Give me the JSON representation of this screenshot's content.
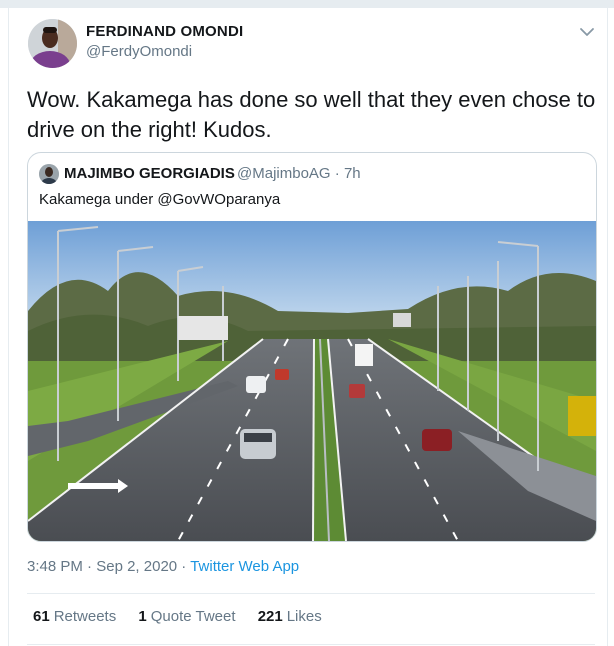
{
  "tweet": {
    "author_name": "FERDINAND OMONDI",
    "author_handle": "@FerdyOmondi",
    "text": "Wow. Kakamega has done so well that they even chose to drive on the right! Kudos.",
    "menu_icon": "chevron-down-icon",
    "time": "3:48 PM",
    "date": "Sep 2, 2020",
    "separator": "·",
    "source_app": "Twitter Web App"
  },
  "quote": {
    "author_name": "MAJIMBO GEORGIADIS",
    "author_handle": "@MajimboAG",
    "separator": "·",
    "age": "7h",
    "text": "Kakamega under @GovWOparanya",
    "media_description_icon": "highway-photo"
  },
  "stats": {
    "retweets_count": "61",
    "retweets_label": "Retweets",
    "quotes_count": "1",
    "quotes_label": "Quote Tweet",
    "likes_count": "221",
    "likes_label": "Likes"
  },
  "colors": {
    "link": "#1b95e0",
    "secondary_text": "#657786",
    "border": "#e6ecf0"
  }
}
